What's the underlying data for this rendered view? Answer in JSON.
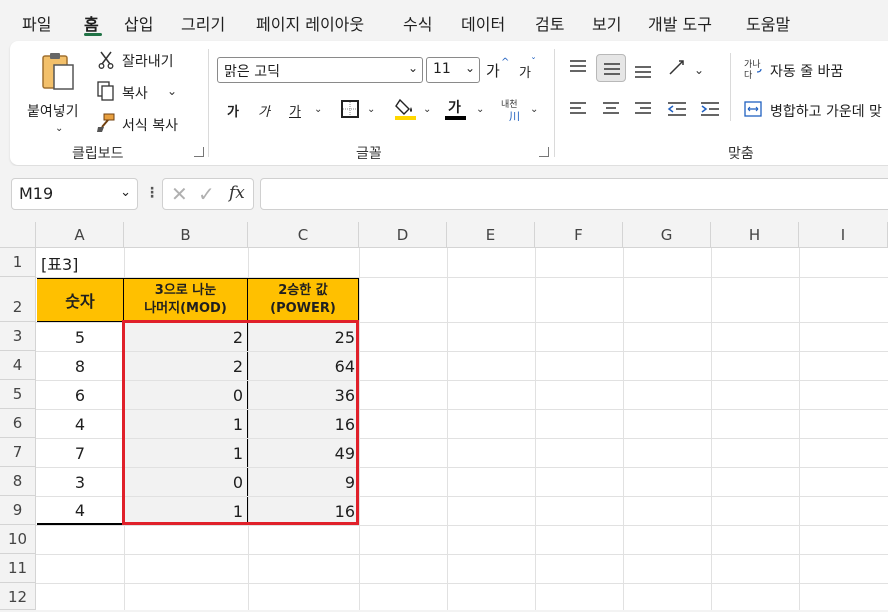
{
  "menu": {
    "tabs": [
      "파일",
      "홈",
      "삽입",
      "그리기",
      "페이지 레이아웃",
      "수식",
      "데이터",
      "검토",
      "보기",
      "개발 도구",
      "도움말"
    ],
    "active": "홈"
  },
  "ribbon": {
    "clipboard": {
      "paste": "붙여넣기",
      "cut": "잘라내기",
      "copy": "복사",
      "format_painter": "서식 복사",
      "label": "클립보드"
    },
    "font": {
      "name": "맑은 고딕",
      "size": "11",
      "grow": "가",
      "shrink": "가",
      "bold": "가",
      "italic": "가",
      "underline": "가",
      "font_color_glyph": "가",
      "phonetic": "내천",
      "label": "글꼴"
    },
    "alignment": {
      "wrap_text": "자동 줄 바꿈",
      "merge_center": "병합하고 가운데 맞",
      "label": "맞춤"
    }
  },
  "formula_bar": {
    "name_box": "M19",
    "fx": "fx",
    "formula": ""
  },
  "sheet": {
    "columns": [
      "A",
      "B",
      "C",
      "D",
      "E",
      "F",
      "G",
      "H",
      "I"
    ],
    "rows": [
      "1",
      "2",
      "3",
      "4",
      "5",
      "6",
      "7",
      "8",
      "9",
      "10",
      "11",
      "12"
    ],
    "title_cell": "[표3]",
    "headers": {
      "a": "숫자",
      "b_line1": "3으로 나눈",
      "b_line2": "나머지(MOD)",
      "c_line1": "2승한 값",
      "c_line2": "(POWER)"
    },
    "data": [
      {
        "num": "5",
        "mod": "2",
        "pow": "25"
      },
      {
        "num": "8",
        "mod": "2",
        "pow": "64"
      },
      {
        "num": "6",
        "mod": "0",
        "pow": "36"
      },
      {
        "num": "4",
        "mod": "1",
        "pow": "16"
      },
      {
        "num": "7",
        "mod": "1",
        "pow": "49"
      },
      {
        "num": "3",
        "mod": "0",
        "pow": "9"
      },
      {
        "num": "4",
        "mod": "1",
        "pow": "16"
      }
    ]
  },
  "colors": {
    "accent": "#217346",
    "header_fill": "#ffc000",
    "highlight_border": "#e0202a"
  }
}
